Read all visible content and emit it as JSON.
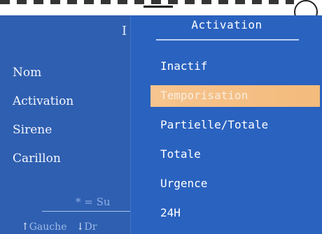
{
  "background_screen": {
    "title_fragment": "I",
    "items": [
      {
        "label": "Nom"
      },
      {
        "label": "Activation"
      },
      {
        "label": "Sirene"
      },
      {
        "label": "Carillon"
      }
    ],
    "footnote": "* = Su",
    "help": {
      "left_arrow": "↑",
      "left_label": "Gauche",
      "right_arrow": "↓",
      "right_label": "Dr"
    }
  },
  "popup": {
    "title": "Activation",
    "selected_index": 1,
    "items": [
      {
        "label": "Inactif"
      },
      {
        "label": "Temporisation"
      },
      {
        "label": "Partielle/Totale"
      },
      {
        "label": "Totale"
      },
      {
        "label": "Urgence"
      },
      {
        "label": "24H"
      }
    ]
  },
  "colors": {
    "screen_blue": "#2e63b6",
    "popup_blue": "#2a62bf",
    "highlight": "#f6c48e"
  }
}
